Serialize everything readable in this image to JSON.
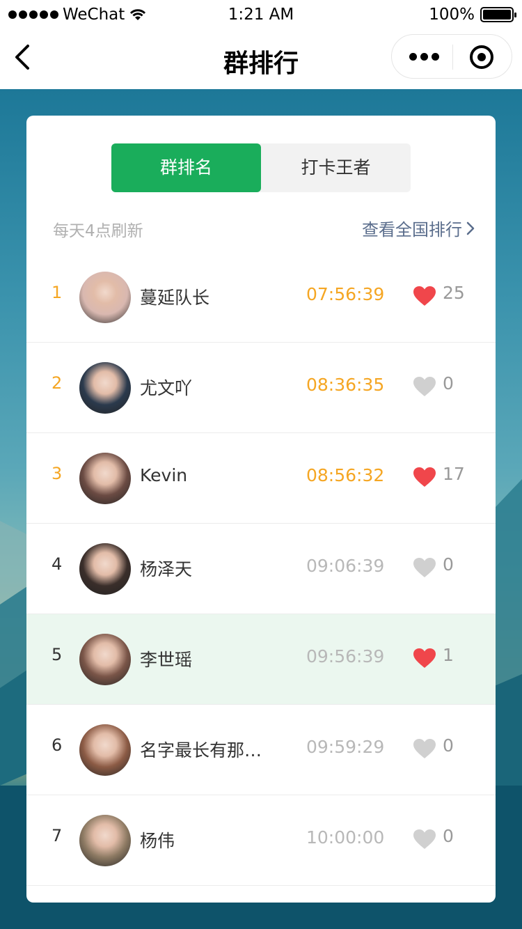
{
  "status_bar": {
    "carrier": "WeChat",
    "time": "1:21 AM",
    "battery": "100%"
  },
  "nav": {
    "title": "群排行",
    "back_icon": "chevron-left-icon",
    "more_icon": "more-dots-icon",
    "close_icon": "target-circle-icon"
  },
  "tabs": [
    {
      "label": "群排名",
      "active": true
    },
    {
      "label": "打卡王者",
      "active": false
    }
  ],
  "refresh_note": "每天4点刷新",
  "national_link": "查看全国排行",
  "colors": {
    "accent_green": "#1aad5b",
    "rank_gold": "#f5a623",
    "heart_red": "#f0464b",
    "heart_gray": "#d0d0d0",
    "highlight_row": "#ebf7ef"
  },
  "rankings": [
    {
      "rank": "1",
      "name": "蔓延队长",
      "time": "07:56:39",
      "liked": true,
      "likes": "25",
      "top": true,
      "avatar": "#d9b8b0"
    },
    {
      "rank": "2",
      "name": "尤文吖",
      "time": "08:36:35",
      "liked": false,
      "likes": "0",
      "top": true,
      "avatar": "#2b3a4d"
    },
    {
      "rank": "3",
      "name": "Kevin",
      "time": "08:56:32",
      "liked": true,
      "likes": "17",
      "top": true,
      "avatar": "#6b4b43"
    },
    {
      "rank": "4",
      "name": "杨泽天",
      "time": "09:06:39",
      "liked": false,
      "likes": "0",
      "top": false,
      "avatar": "#3a2e2a"
    },
    {
      "rank": "5",
      "name": "李世瑶",
      "time": "09:56:39",
      "liked": true,
      "likes": "1",
      "top": false,
      "avatar": "#7a5548",
      "me": true
    },
    {
      "rank": "6",
      "name": "名字最长有那…",
      "time": "09:59:29",
      "liked": false,
      "likes": "0",
      "top": false,
      "avatar": "#8c5b45"
    },
    {
      "rank": "7",
      "name": "杨伟",
      "time": "10:00:00",
      "liked": false,
      "likes": "0",
      "top": false,
      "avatar": "#8d7a63"
    }
  ]
}
